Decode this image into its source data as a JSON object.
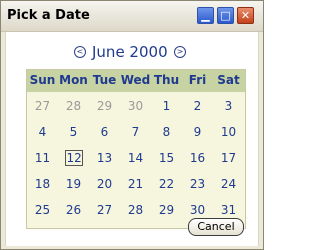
{
  "window": {
    "title": "Pick a Date",
    "controls": {
      "minimize_icon": "minimize-icon",
      "maximize_icon": "maximize-icon",
      "close_icon": "close-icon"
    }
  },
  "calendar": {
    "month_label": "June 2000",
    "prev_icon": "chevron-left-icon",
    "next_icon": "chevron-right-icon",
    "weekdays": [
      "Sun",
      "Mon",
      "Tue",
      "Wed",
      "Thu",
      "Fri",
      "Sat"
    ],
    "weeks": [
      [
        "27",
        "28",
        "29",
        "30",
        "1",
        "2",
        "3"
      ],
      [
        "4",
        "5",
        "6",
        "7",
        "8",
        "9",
        "10"
      ],
      [
        "11",
        "12",
        "13",
        "14",
        "15",
        "16",
        "17"
      ],
      [
        "18",
        "19",
        "20",
        "21",
        "22",
        "23",
        "24"
      ],
      [
        "25",
        "26",
        "27",
        "28",
        "29",
        "30",
        "31"
      ]
    ],
    "other_month_cells": [
      "0-0",
      "0-1",
      "0-2",
      "0-3"
    ],
    "selected_day": "12",
    "colors": {
      "header_bg": "#c7d3a3",
      "body_bg": "#f6f6de",
      "text": "#1f3a8f",
      "muted": "#9a9a9a"
    }
  },
  "actions": {
    "cancel_label": "Cancel"
  }
}
